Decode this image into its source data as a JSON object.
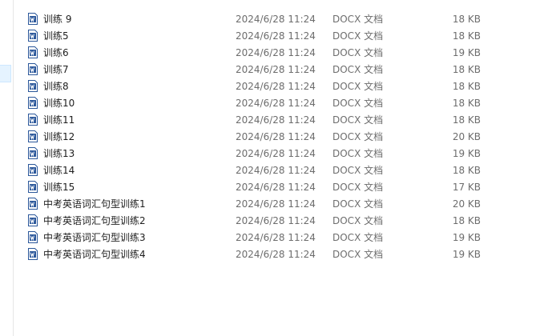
{
  "files": [
    {
      "name": "训练 9",
      "date": "2024/6/28 11:24",
      "type": "DOCX 文档",
      "size": "18 KB",
      "icon": "word-doc-icon"
    },
    {
      "name": "训练5",
      "date": "2024/6/28 11:24",
      "type": "DOCX 文档",
      "size": "18 KB",
      "icon": "word-doc-icon"
    },
    {
      "name": "训练6",
      "date": "2024/6/28 11:24",
      "type": "DOCX 文档",
      "size": "19 KB",
      "icon": "word-doc-icon"
    },
    {
      "name": "训练7",
      "date": "2024/6/28 11:24",
      "type": "DOCX 文档",
      "size": "18 KB",
      "icon": "word-doc-icon"
    },
    {
      "name": "训练8",
      "date": "2024/6/28 11:24",
      "type": "DOCX 文档",
      "size": "18 KB",
      "icon": "word-doc-icon"
    },
    {
      "name": "训练10",
      "date": "2024/6/28 11:24",
      "type": "DOCX 文档",
      "size": "18 KB",
      "icon": "word-doc-icon"
    },
    {
      "name": "训练11",
      "date": "2024/6/28 11:24",
      "type": "DOCX 文档",
      "size": "18 KB",
      "icon": "word-doc-icon"
    },
    {
      "name": "训练12",
      "date": "2024/6/28 11:24",
      "type": "DOCX 文档",
      "size": "20 KB",
      "icon": "word-doc-icon"
    },
    {
      "name": "训练13",
      "date": "2024/6/28 11:24",
      "type": "DOCX 文档",
      "size": "19 KB",
      "icon": "word-doc-icon"
    },
    {
      "name": "训练14",
      "date": "2024/6/28 11:24",
      "type": "DOCX 文档",
      "size": "18 KB",
      "icon": "word-doc-icon"
    },
    {
      "name": "训练15",
      "date": "2024/6/28 11:24",
      "type": "DOCX 文档",
      "size": "17 KB",
      "icon": "word-doc-icon"
    },
    {
      "name": "中考英语词汇句型训练1",
      "date": "2024/6/28 11:24",
      "type": "DOCX 文档",
      "size": "20 KB",
      "icon": "word-doc-icon"
    },
    {
      "name": "中考英语词汇句型训练2",
      "date": "2024/6/28 11:24",
      "type": "DOCX 文档",
      "size": "18 KB",
      "icon": "word-doc-icon"
    },
    {
      "name": "中考英语词汇句型训练3",
      "date": "2024/6/28 11:24",
      "type": "DOCX 文档",
      "size": "19 KB",
      "icon": "word-doc-icon"
    },
    {
      "name": "中考英语词汇句型训练4",
      "date": "2024/6/28 11:24",
      "type": "DOCX 文档",
      "size": "19 KB",
      "icon": "word-doc-icon"
    }
  ],
  "colors": {
    "icon_blue": "#2b579a",
    "icon_page": "#ffffff",
    "text_primary": "#1e1e1e",
    "text_secondary": "#6d6d6d"
  }
}
